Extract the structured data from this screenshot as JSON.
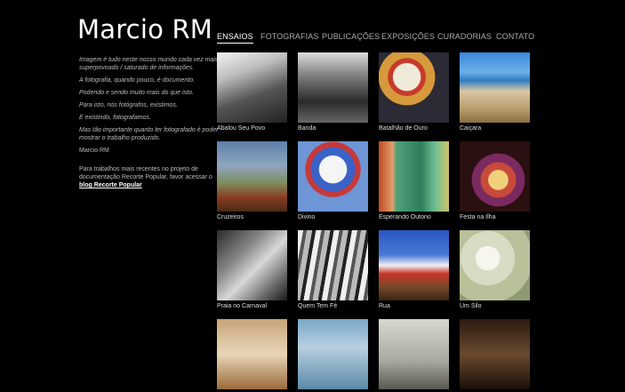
{
  "header": {
    "logo": "Marcio RM"
  },
  "nav": [
    {
      "label": "ENSAIOS",
      "active": true
    },
    {
      "label": "FOTOGRAFIAS",
      "active": false
    },
    {
      "label": "PUBLICAÇÕES",
      "active": false
    },
    {
      "label": "EXPOSIÇÕES",
      "active": false
    },
    {
      "label": "CURADORIAS",
      "active": false
    },
    {
      "label": "CONTATO",
      "active": false
    }
  ],
  "sidebar": {
    "quote": [
      "Imagem é tudo neste nosso mundo cada vez mais superpovoado / saturado de informações.",
      "A fotografia, quando pouco, é documento.",
      "Podendo e sendo muito mais do que isto.",
      "Para isto, nós fotógrafos, existimos.",
      "E existindo, fotografamos.",
      "Mas tão importante quanto ter fotografado é poder mostrar o trabalho produzido."
    ],
    "signature": "Marcio RM",
    "cta_text": "Para trabalhos mais recentes no projeto de documentação Recorte Popular, favor acessar o",
    "cta_link": "blog Recorte Popular"
  },
  "gallery": [
    {
      "caption": "Abalou Seu Povo"
    },
    {
      "caption": "Banda"
    },
    {
      "caption": "Batalhão de Ouro"
    },
    {
      "caption": "Caiçara"
    },
    {
      "caption": "Cruzeiros"
    },
    {
      "caption": "Divino"
    },
    {
      "caption": "Esperando Outono"
    },
    {
      "caption": "Festa na Ilha"
    },
    {
      "caption": "Praia no Carnaval"
    },
    {
      "caption": "Quem Tem Fé"
    },
    {
      "caption": "Rua"
    },
    {
      "caption": "Um Silo"
    },
    {
      "caption": ""
    },
    {
      "caption": ""
    },
    {
      "caption": ""
    },
    {
      "caption": ""
    }
  ]
}
